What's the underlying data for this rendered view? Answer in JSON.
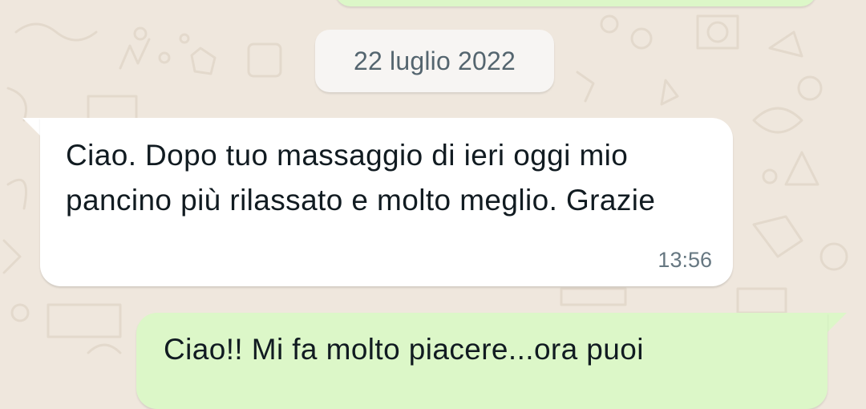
{
  "chat": {
    "date_separator": "22 luglio 2022",
    "messages": [
      {
        "direction": "incoming",
        "text": "Ciao. Dopo tuo massaggio di ieri oggi mio pancino più rilassato e molto meglio. Grazie",
        "time": "13:56"
      },
      {
        "direction": "outgoing",
        "text": "Ciao!! Mi fa molto piacere...ora puoi"
      }
    ]
  },
  "colors": {
    "wallpaper": "#efe7dd",
    "incoming_bubble": "#ffffff",
    "outgoing_bubble": "#dcf7c8",
    "date_chip": "#f7f5f3",
    "text": "#111b21",
    "meta_text": "#667781"
  }
}
